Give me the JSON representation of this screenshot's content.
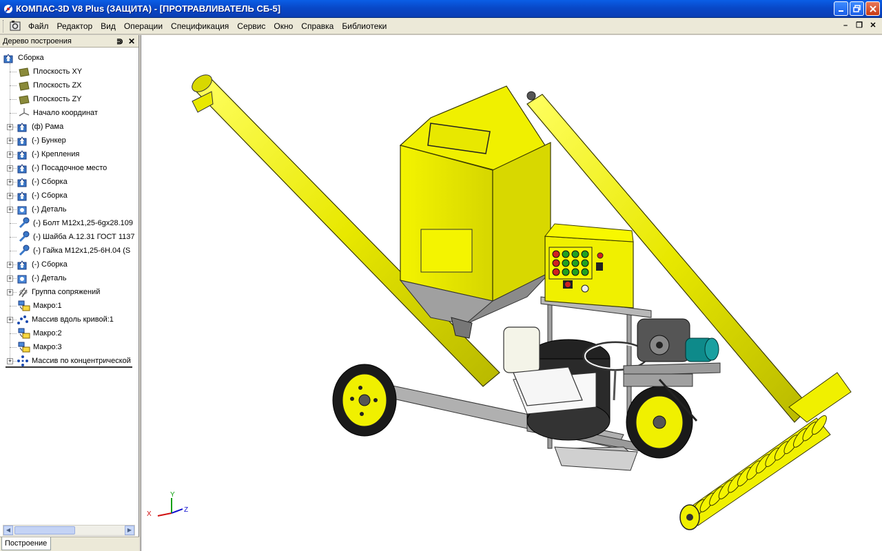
{
  "window": {
    "title": "КОМПАС-3D V8 Plus (ЗАЩИТА) - [ПРОТРАВЛИВАТЕЛЬ СБ-5]",
    "buttons": [
      "minimize-icon",
      "restore-icon",
      "close-icon"
    ]
  },
  "menu": {
    "items": [
      {
        "label": "Файл"
      },
      {
        "label": "Редактор"
      },
      {
        "label": "Вид"
      },
      {
        "label": "Операции"
      },
      {
        "label": "Спецификация"
      },
      {
        "label": "Сервис"
      },
      {
        "label": "Окно"
      },
      {
        "label": "Справка"
      },
      {
        "label": "Библиотеки"
      }
    ],
    "mdi_buttons": [
      "minimize-icon",
      "restore-icon",
      "close-icon"
    ]
  },
  "tree": {
    "header": "Дерево построения",
    "items": [
      {
        "label": "Сборка",
        "icon": "assembly-icon",
        "level": 0,
        "expander": false
      },
      {
        "label": "Плоскость XY",
        "icon": "plane-icon",
        "level": 1,
        "expander": false
      },
      {
        "label": "Плоскость ZX",
        "icon": "plane-icon",
        "level": 1,
        "expander": false
      },
      {
        "label": "Плоскость ZY",
        "icon": "plane-icon",
        "level": 1,
        "expander": false
      },
      {
        "label": "Начало координат",
        "icon": "origin-icon",
        "level": 1,
        "expander": false
      },
      {
        "label": "(ф) Рама",
        "icon": "assembly-icon",
        "level": 1,
        "expander": true
      },
      {
        "label": "(-) Бункер",
        "icon": "assembly-icon",
        "level": 1,
        "expander": true
      },
      {
        "label": "(-) Крепления",
        "icon": "assembly-icon",
        "level": 1,
        "expander": true
      },
      {
        "label": "(-) Посадочное место",
        "icon": "assembly-icon",
        "level": 1,
        "expander": true
      },
      {
        "label": "(-) Сборка",
        "icon": "assembly-icon",
        "level": 1,
        "expander": true
      },
      {
        "label": "(-) Сборка",
        "icon": "assembly-icon",
        "level": 1,
        "expander": true
      },
      {
        "label": "(-) Деталь",
        "icon": "part-icon",
        "level": 1,
        "expander": true
      },
      {
        "label": "(-) Болт М12х1,25-6gх28.109",
        "icon": "bolt-icon",
        "level": 1,
        "expander": false
      },
      {
        "label": "(-) Шайба А.12.31 ГОСТ 1137",
        "icon": "bolt-icon",
        "level": 1,
        "expander": false
      },
      {
        "label": "(-) Гайка  М12х1,25-6Н.04 (S",
        "icon": "bolt-icon",
        "level": 1,
        "expander": false
      },
      {
        "label": "(-) Сборка",
        "icon": "assembly-icon",
        "level": 1,
        "expander": true
      },
      {
        "label": "(-) Деталь",
        "icon": "part-icon",
        "level": 1,
        "expander": true
      },
      {
        "label": "Группа сопряжений",
        "icon": "mates-icon",
        "level": 1,
        "expander": true
      },
      {
        "label": "Макро:1",
        "icon": "macro-icon",
        "level": 1,
        "expander": false
      },
      {
        "label": "Массив вдоль кривой:1",
        "icon": "curve-array-icon",
        "level": 1,
        "expander": true
      },
      {
        "label": "Макро:2",
        "icon": "macro-icon",
        "level": 1,
        "expander": false
      },
      {
        "label": "Макро:3",
        "icon": "macro-icon",
        "level": 1,
        "expander": false
      },
      {
        "label": "Массив по концентрической",
        "icon": "circular-array-icon",
        "level": 1,
        "expander": true
      }
    ],
    "tab": "Построение"
  },
  "viewport": {
    "axis_labels": {
      "x": "X",
      "y": "Y",
      "z": "Z"
    },
    "colors": {
      "body": "#f0f000",
      "outline": "#3a3a00",
      "metal": "#a8a8a8",
      "dark": "#2a2a2a"
    }
  }
}
